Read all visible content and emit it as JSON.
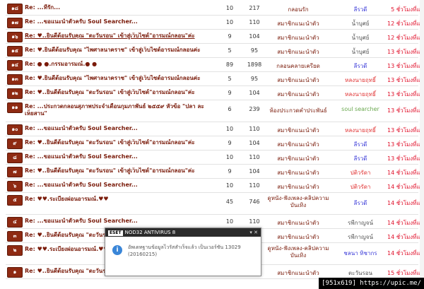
{
  "rows": [
    {
      "num": "๑๘",
      "title": "Re: ...ที่รัก...",
      "replies": "10",
      "views": "217",
      "status": "กลอนรัก",
      "user": "ลีรวดี",
      "user_color": "#3a3ad8",
      "time": "5 ชั่วโมงที่แล้ว",
      "underline": false
    },
    {
      "num": "๑๗",
      "title": "Re: ...ขอแนะนำตัวครับ Soul Searcher...",
      "replies": "10",
      "views": "110",
      "status": "สมาชิกแนะนำตัว",
      "user": "น้ำบุศย์",
      "user_color": "#555555",
      "time": "12 ชั่วโมงที่แล้ว",
      "underline": false
    },
    {
      "num": "๑๖",
      "title": "Re: ♥..ยินดีต้อนรับคุณ \"ตะวันรอน\" เข้าสู่เว็บไซต์\"อารมณ์กลอน\"ค่ะ",
      "replies": "9",
      "views": "104",
      "status": "สมาชิกแนะนำตัว",
      "user": "น้ำบุศย์",
      "user_color": "#555555",
      "time": "12 ชั่วโมงที่แล้ว",
      "underline": true
    },
    {
      "num": "๑๕",
      "title": "Re: ♥.ยินดีต้อนรับคุณ \"ไพศาลนาคราช\" เข้าสู่เว็บไซต์อารมณ์กลอนค่ะ",
      "replies": "5",
      "views": "95",
      "status": "สมาชิกแนะนำตัว",
      "user": "น้ำบุศย์",
      "user_color": "#555555",
      "time": "13 ชั่วโมงที่แล้ว",
      "underline": false
    },
    {
      "num": "๑๔",
      "title": "Re: ● ●.กรรมอารมณ์.● ●",
      "replies": "89",
      "views": "1898",
      "status": "กลอนคลายเครียด",
      "user": "ลีรวดี",
      "user_color": "#3a3ad8",
      "time": "13 ชั่วโมงที่แล้ว",
      "underline": false
    },
    {
      "num": "๑๓",
      "title": "Re: ♥.ยินดีต้อนรับคุณ \"ไพศาลนาคราช\" เข้าสู่เว็บไซต์อารมณ์กลอนค่ะ",
      "replies": "5",
      "views": "95",
      "status": "สมาชิกแนะนำตัว",
      "user": "หลงนายฤทธิ์",
      "user_color": "#e03030",
      "time": "13 ชั่วโมงที่แล้ว",
      "underline": false
    },
    {
      "num": "๑๒",
      "title": "Re: ♥..ยินดีต้อนรับคุณ \"ตะวันรอน\" เข้าสู่เว็บไซต์\"อารมณ์กลอน\"ค่ะ",
      "replies": "9",
      "views": "104",
      "status": "สมาชิกแนะนำตัว",
      "user": "หลงนายฤทธิ์",
      "user_color": "#e03030",
      "time": "13 ชั่วโมงที่แล้ว",
      "underline": false
    },
    {
      "num": "๑๑",
      "title": "Re: ...ประกวดกลอนสุภาพประจำเดือนกุมภาพันธ์ ๒๕๕๙ หัวข้อ \"ปลา ละเห็ยสาน\"",
      "replies": "6",
      "views": "239",
      "status": "ห้องประกวดคำประพันธ์",
      "user": "soul searcher",
      "user_color": "#6aa84f",
      "time": "13 ชั่วโมงที่แล้ว",
      "underline": false,
      "tall": true
    },
    {
      "num": "๑๐",
      "title": "Re: ...ขอแนะนำตัวครับ Soul Searcher...",
      "replies": "10",
      "views": "110",
      "status": "สมาชิกแนะนำตัว",
      "user": "หลงนายฤทธิ์",
      "user_color": "#e03030",
      "time": "13 ชั่วโมงที่แล้ว",
      "underline": false
    },
    {
      "num": "๙",
      "title": "Re: ♥..ยินดีต้อนรับคุณ \"ตะวันรอน\" เข้าสู่เว็บไซต์\"อารมณ์กลอน\"ค่ะ",
      "replies": "9",
      "views": "104",
      "status": "สมาชิกแนะนำตัว",
      "user": "ลีรวดี",
      "user_color": "#3a3ad8",
      "time": "13 ชั่วโมงที่แล้ว",
      "underline": false
    },
    {
      "num": "๘",
      "title": "Re: ...ขอแนะนำตัวครับ Soul Searcher...",
      "replies": "10",
      "views": "110",
      "status": "สมาชิกแนะนำตัว",
      "user": "ลีรวดี",
      "user_color": "#3a3ad8",
      "time": "13 ชั่วโมงที่แล้ว",
      "underline": false
    },
    {
      "num": "๗",
      "title": "Re: ♥..ยินดีต้อนรับคุณ \"ตะวันรอน\" เข้าสู่เว็บไซต์\"อารมณ์กลอน\"ค่ะ",
      "replies": "9",
      "views": "104",
      "status": "สมาชิกแนะนำตัว",
      "user": "ปติวรัดา",
      "user_color": "#e03030",
      "time": "14 ชั่วโมงที่แล้ว",
      "underline": false
    },
    {
      "num": "๖",
      "title": "Re: ...ขอแนะนำตัวครับ Soul Searcher...",
      "replies": "10",
      "views": "110",
      "status": "สมาชิกแนะนำตัว",
      "user": "ปติวรัดา",
      "user_color": "#e03030",
      "time": "14 ชั่วโมงที่แล้ว",
      "underline": false
    },
    {
      "num": "๕",
      "title": "Re: ♥♥.ระเบียงผ่อนอารมณ์.♥♥",
      "replies": "45",
      "views": "746",
      "status": "ดูหนัง-ฟังเพลง-คลิปความบันเทิง",
      "user": "ลีรวดี",
      "user_color": "#3a3ad8",
      "time": "14 ชั่วโมงที่แล้ว",
      "underline": false,
      "tall": true,
      "tall2": true
    },
    {
      "num": "๔",
      "title": "Re: ...ขอแนะนำตัวครับ Soul Searcher...",
      "replies": "10",
      "views": "110",
      "status": "สมาชิกแนะนำตัว",
      "user": "รพีกาญจน์",
      "user_color": "#555555",
      "time": "14 ชั่วโมงที่แล้ว",
      "underline": false
    },
    {
      "num": "๓",
      "title": "Re: ♥..ยินดีต้อนรับคุณ \"ตะวันรอน\" เข้าสู่เว็บไซต์\"อารมณ์กลอน\"ค่ะ",
      "replies": "9",
      "views": "104",
      "status": "สมาชิกแนะนำตัว",
      "user": "รพีกาญจน์",
      "user_color": "#555555",
      "time": "14 ชั่วโมงที่แล้ว",
      "underline": false
    },
    {
      "num": "๒",
      "title": "Re: ♥♥.ระเบียงผ่อนอารมณ์.♥♥",
      "replies": "45",
      "views": "746",
      "status": "ดูหนัง-ฟังเพลง-คลิปความบันเทิง",
      "user": "ชลนา ทิชากร",
      "user_color": "#3a3ad8",
      "time": "14 ชั่วโมงที่แล้ว",
      "underline": false,
      "tall": true,
      "tall2": true
    },
    {
      "num": "๑",
      "title": "Re: ♥..ยินดีต้อนรับคุณ \"ตะวันรอน\" เข้าสู่เว็บไซต์\"อารมณ์กลอน\"ค่ะ",
      "replies": "9",
      "views": "104",
      "status": "สมาชิกแนะนำตัว",
      "user": "ตะวันรอน",
      "user_color": "#555555",
      "time": "15 ชั่วโมงที่แล้ว",
      "underline": false
    }
  ],
  "colors": {
    "badge": "#8e2a12",
    "title": "#7a1b0a",
    "time": "#e0102a"
  },
  "popup": {
    "logo": "ESET",
    "title": "NOD32 ANTIVIRUS 8",
    "icon": "info-icon",
    "message": "อัพเดทฐานข้อมูลไวรัสสำเร็จแล้ว เป็นเวอร์ชัน 13029 (20160215)"
  },
  "watermark": "[951x619] https://upic.me/"
}
